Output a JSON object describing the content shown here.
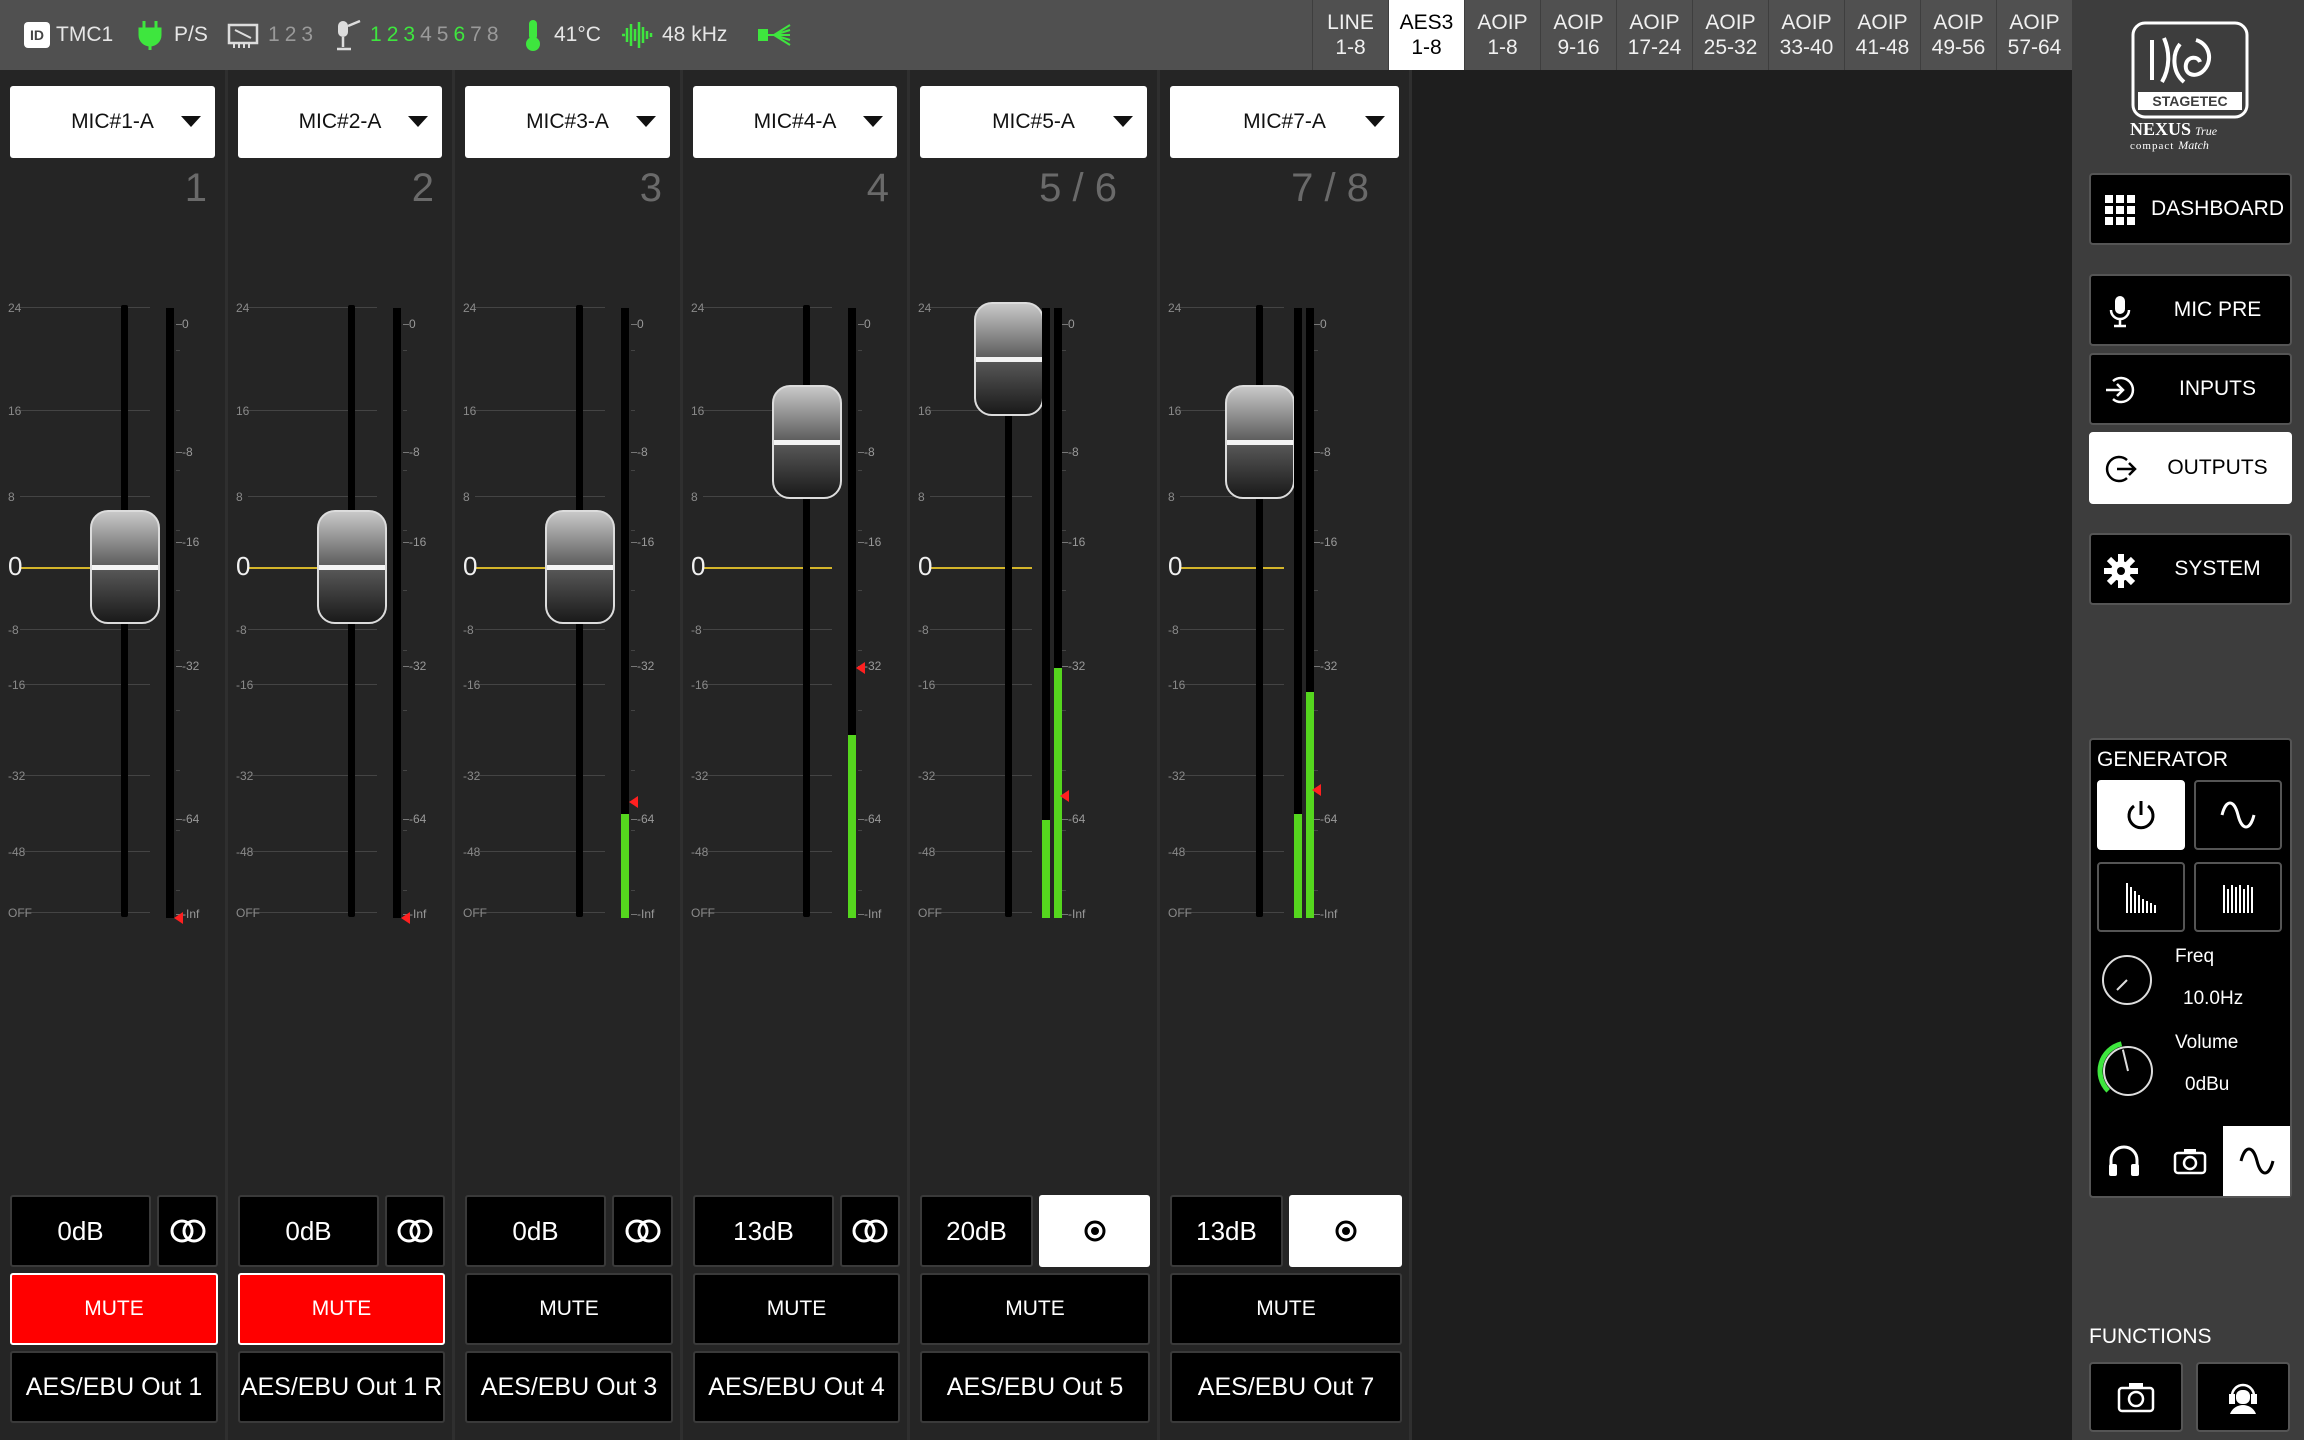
{
  "status_bar": {
    "id_badge": "ID",
    "unit_name": "TMC1",
    "power_label": "P/S",
    "network_ports": [
      "1",
      "2",
      "3"
    ],
    "mic_slots": [
      {
        "num": "1",
        "active": true
      },
      {
        "num": "2",
        "active": true
      },
      {
        "num": "3",
        "active": true
      },
      {
        "num": "4",
        "active": false
      },
      {
        "num": "5",
        "active": false
      },
      {
        "num": "6",
        "active": true
      },
      {
        "num": "7",
        "active": false
      },
      {
        "num": "8",
        "active": false
      }
    ],
    "temperature": "41°C",
    "sample_rate": "48 kHz"
  },
  "source_tabs": [
    {
      "top": "LINE",
      "bottom": "1-8",
      "active": false
    },
    {
      "top": "AES3",
      "bottom": "1-8",
      "active": true
    },
    {
      "top": "AOIP",
      "bottom": "1-8",
      "active": false
    },
    {
      "top": "AOIP",
      "bottom": "9-16",
      "active": false
    },
    {
      "top": "AOIP",
      "bottom": "17-24",
      "active": false
    },
    {
      "top": "AOIP",
      "bottom": "25-32",
      "active": false
    },
    {
      "top": "AOIP",
      "bottom": "33-40",
      "active": false
    },
    {
      "top": "AOIP",
      "bottom": "41-48",
      "active": false
    },
    {
      "top": "AOIP",
      "bottom": "49-56",
      "active": false
    },
    {
      "top": "AOIP",
      "bottom": "57-64",
      "active": false
    }
  ],
  "fader_scale": [
    "24",
    "16",
    "8",
    "0",
    "-8",
    "-16",
    "-32",
    "-48",
    "OFF"
  ],
  "meter_scale": [
    "0",
    "-8",
    "-16",
    "-32",
    "-64",
    "-Inf"
  ],
  "channels": [
    {
      "source": "MIC#1-A",
      "number": "1",
      "gain_db": 0,
      "gain_label": "0dB",
      "link_icon": "stereo-link-icon",
      "link_active": false,
      "mute_label": "MUTE",
      "muted": true,
      "output": "AES/EBU Out 1",
      "meter_levels": [
        0.0
      ],
      "peak_marks": [
        0.0
      ]
    },
    {
      "source": "MIC#2-A",
      "number": "2",
      "gain_db": 0,
      "gain_label": "0dB",
      "link_icon": "stereo-link-icon",
      "link_active": false,
      "mute_label": "MUTE",
      "muted": true,
      "output": "AES/EBU Out 1 R",
      "meter_levels": [
        0.0
      ],
      "peak_marks": [
        0.0
      ]
    },
    {
      "source": "MIC#3-A",
      "number": "3",
      "gain_db": 0,
      "gain_label": "0dB",
      "link_icon": "stereo-link-icon",
      "link_active": false,
      "mute_label": "MUTE",
      "muted": false,
      "output": "AES/EBU Out 3",
      "meter_levels": [
        0.17
      ],
      "peak_marks": [
        0.19
      ]
    },
    {
      "source": "MIC#4-A",
      "number": "4",
      "gain_db": 13,
      "gain_label": "13dB",
      "link_icon": "stereo-link-icon",
      "link_active": false,
      "mute_label": "MUTE",
      "muted": false,
      "output": "AES/EBU Out 4",
      "meter_levels": [
        0.3
      ],
      "peak_marks": [
        0.41
      ]
    },
    {
      "source": "MIC#5-A",
      "number": "5 / 6",
      "gain_db": 20,
      "gain_label": "20dB",
      "link_icon": "mono-icon",
      "link_active": true,
      "mute_label": "MUTE",
      "muted": false,
      "output": "AES/EBU Out 5",
      "meter_levels": [
        0.16,
        0.41
      ],
      "peak_marks": [
        0.2
      ]
    },
    {
      "source": "MIC#7-A",
      "number": "7 / 8",
      "gain_db": 13,
      "gain_label": "13dB",
      "link_icon": "mono-icon",
      "link_active": true,
      "mute_label": "MUTE",
      "muted": false,
      "output": "AES/EBU Out 7",
      "meter_levels": [
        0.17,
        0.37
      ],
      "peak_marks": [
        0.21
      ]
    }
  ],
  "sidebar": {
    "brand": "STAGETEC",
    "product_line1": "NEXUS",
    "product_line2": "compact",
    "tagline1": "True",
    "tagline2": "Match",
    "nav": [
      {
        "label": "DASHBOARD",
        "icon": "grid-icon",
        "active": false
      },
      {
        "label": "MIC PRE",
        "icon": "microphone-icon",
        "active": false
      },
      {
        "label": "INPUTS",
        "icon": "input-icon",
        "active": false
      },
      {
        "label": "OUTPUTS",
        "icon": "output-icon",
        "active": true
      },
      {
        "label": "SYSTEM",
        "icon": "gear-icon",
        "active": false
      }
    ],
    "generator": {
      "title": "GENERATOR",
      "freq_label": "Freq",
      "freq_value": "10.0Hz",
      "volume_label": "Volume",
      "volume_value": "0dBu",
      "volume_level": 0.45
    },
    "functions_title": "FUNCTIONS"
  },
  "colors": {
    "accent_green": "#55d61e",
    "mute_red": "#ff0000",
    "zero_line": "#d4b52a",
    "peak_red": "#ff2020"
  }
}
